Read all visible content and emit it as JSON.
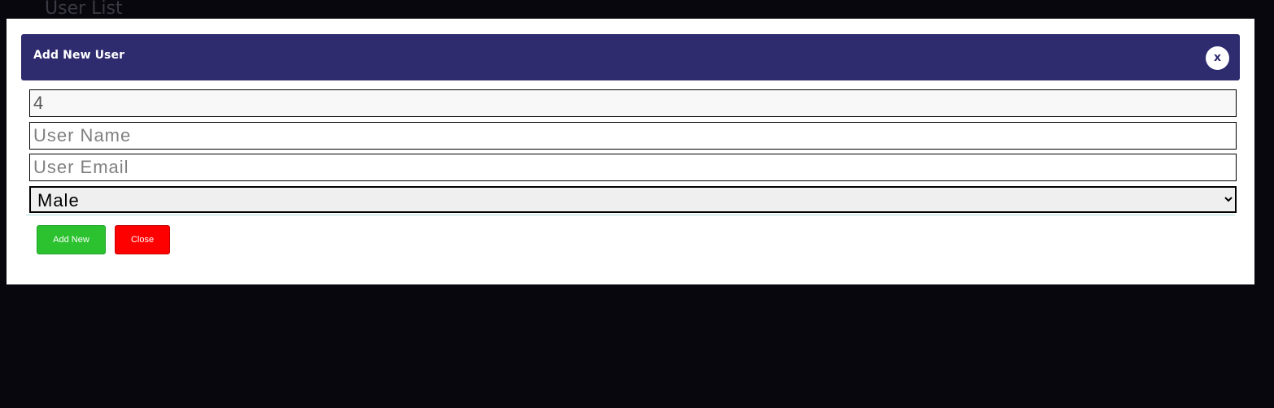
{
  "background": {
    "page_title": "User List"
  },
  "modal": {
    "title": "Add New User",
    "close_icon_label": "x",
    "fields": {
      "id_value": "4",
      "name_placeholder": "User Name",
      "email_placeholder": "User Email",
      "gender_selected": "Male"
    },
    "buttons": {
      "add_label": "Add New",
      "close_label": "Close"
    }
  },
  "colors": {
    "header": "#2e2b6e",
    "add_button": "#2cc22f",
    "close_button": "#ff0000",
    "backdrop": "#08070d"
  }
}
